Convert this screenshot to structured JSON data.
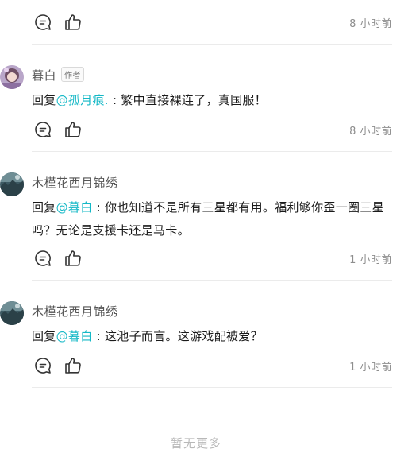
{
  "thread": {
    "top_action": {
      "time": "8 小时前"
    },
    "replies": [
      {
        "username": "暮白",
        "author_badge": "作者",
        "reply_prefix": "回复",
        "mention": "@孤月痕.",
        "text": " : 繁中直接裸连了，真国服！",
        "time": "8 小时前"
      },
      {
        "username": "木槿花西月锦绣",
        "reply_prefix": "回复",
        "mention": "@暮白",
        "text": " : 你也知道不是所有三星都有用。福利够你歪一圈三星吗？无论是支援卡还是马卡。",
        "time": "1 小时前"
      },
      {
        "username": "木槿花西月锦绣",
        "reply_prefix": "回复",
        "mention": "@暮白",
        "text": " : 这池子而言。这游戏配被爱？",
        "time": "1 小时前"
      }
    ]
  },
  "footer": {
    "no_more": "暂无更多"
  },
  "icons": {
    "comment": "comment-bubble-icon",
    "like": "thumbs-up-icon"
  },
  "colors": {
    "mention": "#14b8c6",
    "meta": "#8e8e8e",
    "divider": "#ebebeb"
  }
}
